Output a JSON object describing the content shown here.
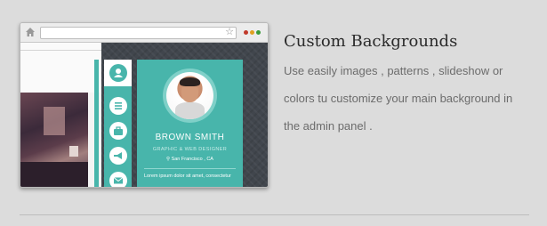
{
  "browser": {
    "dot_colors": [
      "#c0392b",
      "#e0a020",
      "#3a9a3a"
    ]
  },
  "preview": {
    "profile_name": "BROWN SMITH",
    "profile_role": "GRAPHIC & WEB DESIGNER",
    "profile_location": "San Francisco , CA",
    "profile_bio": "Lorem ipsum dolor sit amet, consectetur",
    "nav_icons": [
      "user-icon",
      "list-icon",
      "briefcase-icon",
      "megaphone-icon",
      "envelope-icon"
    ],
    "accent_color": "#48b5ab"
  },
  "feature": {
    "title": "Custom Backgrounds",
    "description_lines": [
      "Use easily images , patterns , slideshow or",
      "colors tu customize your main background in",
      "the admin panel ."
    ]
  }
}
